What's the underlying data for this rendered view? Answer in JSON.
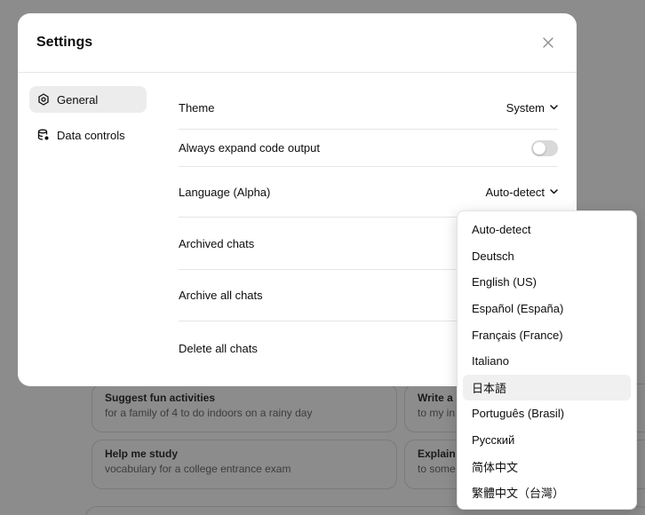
{
  "background": {
    "cards": [
      {
        "title": "Suggest fun activities",
        "subtitle": "for a family of 4 to do indoors on a rainy day"
      },
      {
        "title": "Write a",
        "subtitle": "to my in"
      },
      {
        "title": "Help me study",
        "subtitle": "vocabulary for a college entrance exam"
      },
      {
        "title": "Explain",
        "subtitle": "to some"
      }
    ]
  },
  "dialog": {
    "title": "Settings",
    "close_icon": "close-icon",
    "sidebar": {
      "items": [
        {
          "label": "General",
          "icon": "gear-icon",
          "active": true
        },
        {
          "label": "Data controls",
          "icon": "database-icon",
          "active": false
        }
      ]
    },
    "settings": {
      "theme": {
        "label": "Theme",
        "value": "System"
      },
      "code_output": {
        "label": "Always expand code output",
        "enabled": false
      },
      "language": {
        "label": "Language (Alpha)",
        "value": "Auto-detect"
      },
      "archived": {
        "label": "Archived chats"
      },
      "archive_all": {
        "label": "Archive all chats"
      },
      "delete_all": {
        "label": "Delete all chats"
      }
    }
  },
  "language_menu": {
    "options": [
      "Auto-detect",
      "Deutsch",
      "English (US)",
      "Español (España)",
      "Français (France)",
      "Italiano",
      "日本語",
      "Português (Brasil)",
      "Русский",
      "简体中文",
      "繁體中文（台灣）"
    ],
    "hovered": "日本語"
  },
  "colors": {
    "overlay": "#8c8c8c",
    "dialog_bg": "#ffffff",
    "active_nav": "#ececec",
    "toggle_off": "#d9d9d9",
    "divider": "#e5e5e5"
  }
}
